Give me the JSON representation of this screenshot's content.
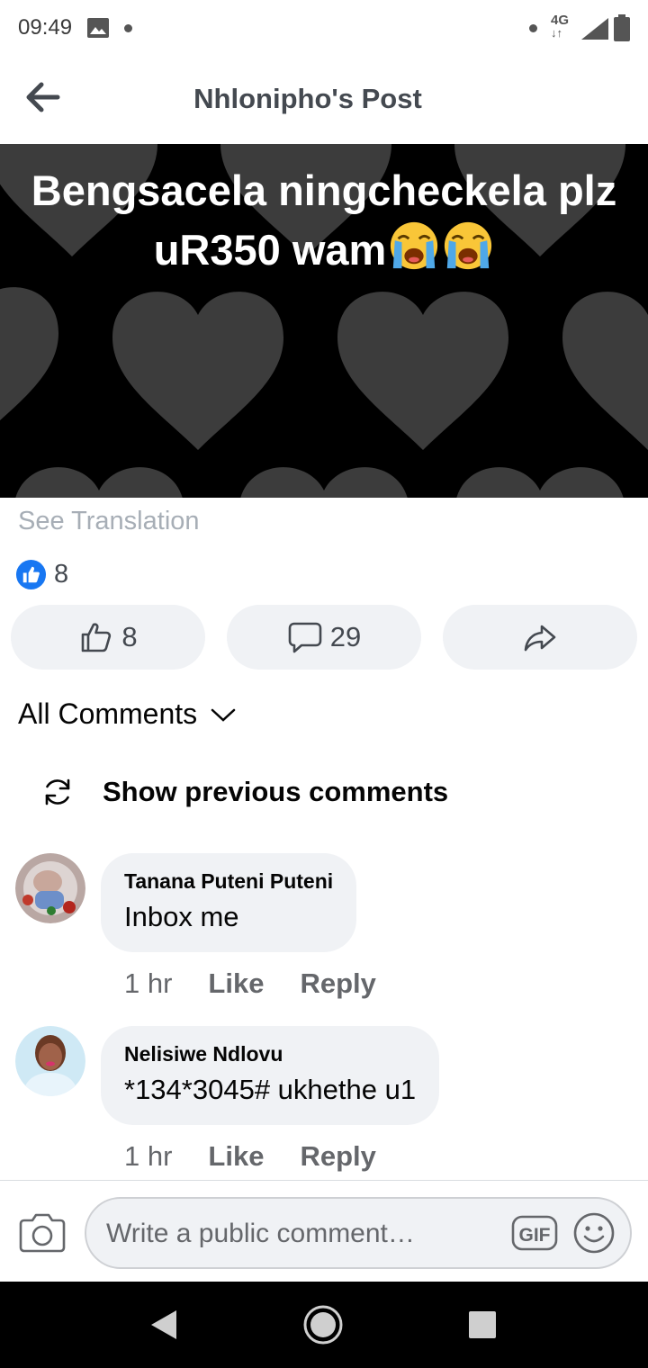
{
  "status_bar": {
    "time": "09:49",
    "network": "4G"
  },
  "header": {
    "title": "Nhlonipho's Post"
  },
  "post": {
    "text_line1": "Bengsacela ningcheckela plz",
    "text_line2": "uR350 wam",
    "emoji": [
      "crying-face",
      "crying-face"
    ]
  },
  "see_translation": "See Translation",
  "reactions": {
    "count": "8"
  },
  "actions": {
    "like_count": "8",
    "comment_count": "29"
  },
  "comments_filter": "All Comments",
  "show_previous": "Show previous comments",
  "comments": [
    {
      "name": "Tanana Puteni Puteni",
      "text": "Inbox me",
      "time": "1 hr",
      "like": "Like",
      "reply": "Reply"
    },
    {
      "name": "Nelisiwe Ndlovu",
      "text": "*134*3045# ukhethe u1",
      "time": "1 hr",
      "like": "Like",
      "reply": "Reply"
    }
  ],
  "composer": {
    "placeholder": "Write a public comment…",
    "gif": "GIF"
  },
  "colors": {
    "accent": "#1877f2",
    "pill_bg": "#f0f2f5",
    "secondary_text": "#65676b"
  }
}
